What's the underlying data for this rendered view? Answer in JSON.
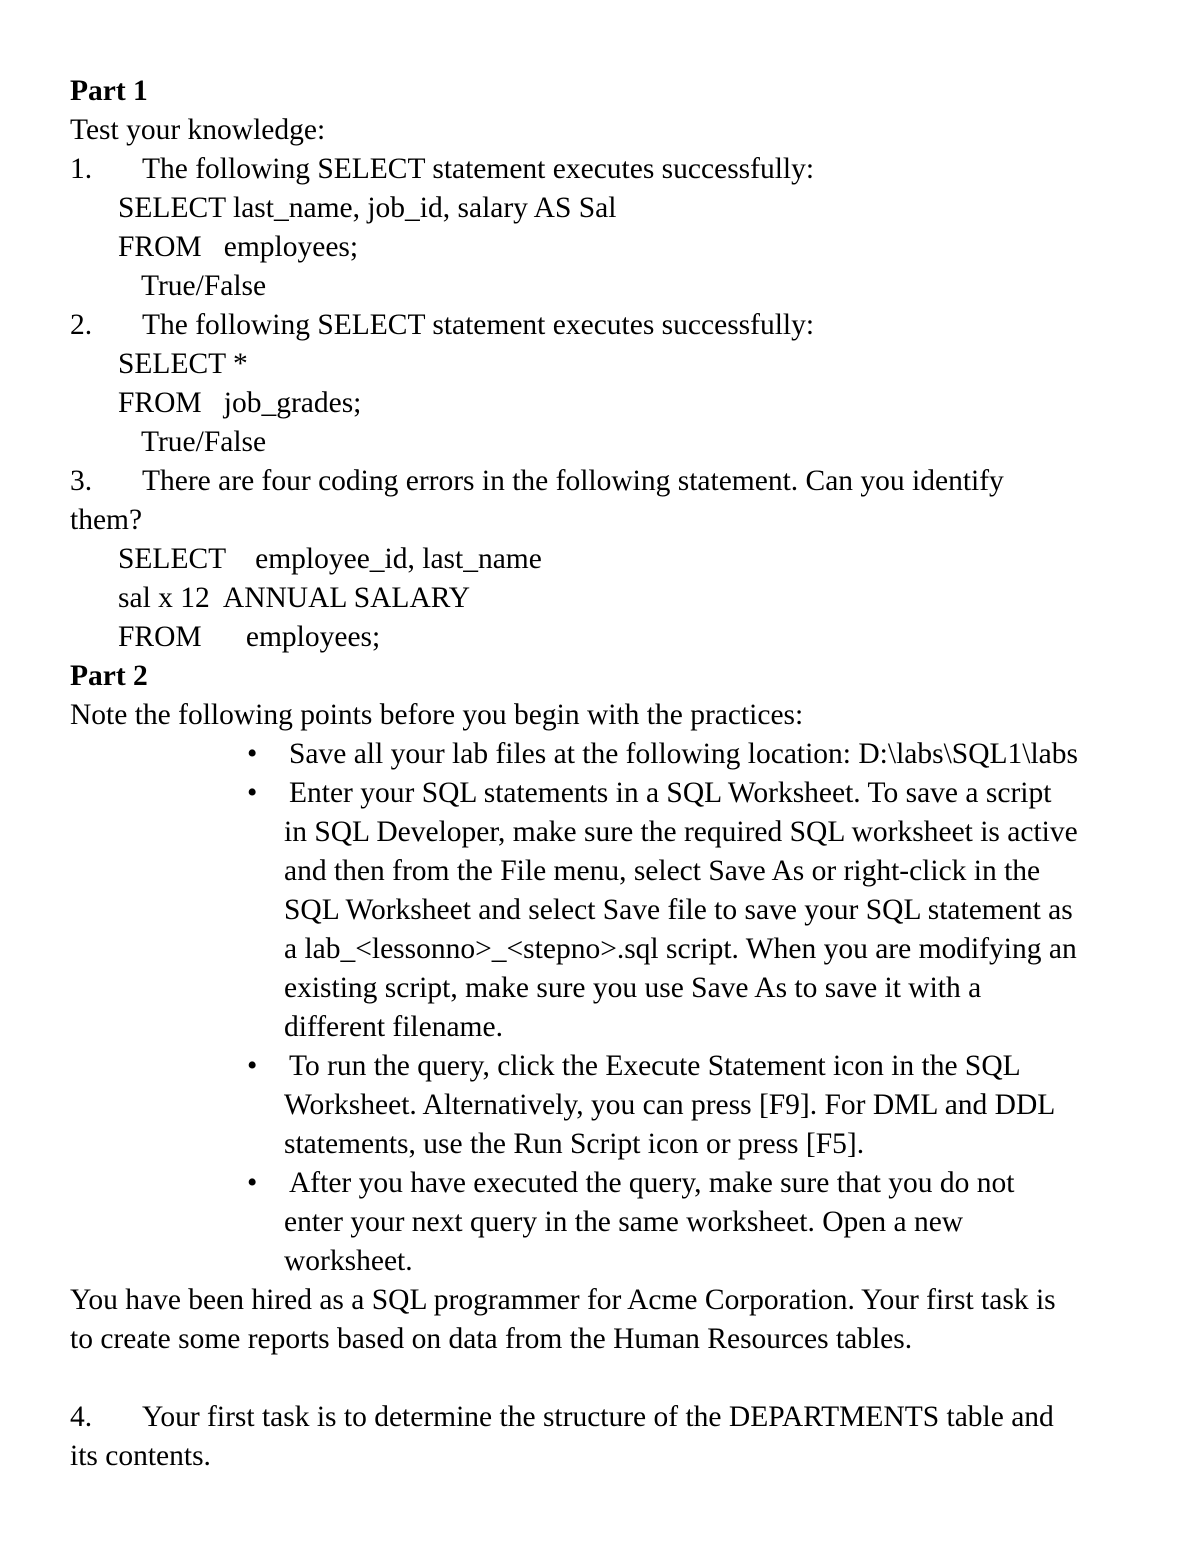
{
  "document": {
    "part1": {
      "heading": "Part 1",
      "intro": "Test your knowledge:",
      "questions": [
        {
          "number": "1.",
          "prompt": "The following SELECT statement executes successfully:",
          "code": [
            "SELECT last_name, job_id, salary AS Sal",
            "FROM   employees;"
          ],
          "answer": "True/False"
        },
        {
          "number": "2.",
          "prompt": "The following SELECT statement executes successfully:",
          "code": [
            "SELECT *",
            "FROM   job_grades;"
          ],
          "answer": "True/False"
        },
        {
          "number": "3.",
          "prompt": "There are four coding errors in the following statement. Can you identify",
          "prompt_cont": "them?",
          "code": [
            "SELECT    employee_id, last_name",
            "sal x 12  ANNUAL SALARY",
            "FROM      employees;"
          ]
        }
      ]
    },
    "part2": {
      "heading": "Part 2",
      "intro": "Note the following points before you begin with the practices:",
      "bullet_glyph": "•",
      "bullets": [
        [
          "Save all your lab files at the following location: D:\\labs\\SQL1\\labs"
        ],
        [
          "Enter your SQL statements in a SQL Worksheet. To save a script",
          "in SQL Developer, make sure the required SQL worksheet is active",
          "and then from the File menu, select Save As or right-click in the",
          "SQL Worksheet and select Save file to save your SQL statement as",
          "a lab_<lessonno>_<stepno>.sql script. When you are modifying an",
          "existing script, make sure you use Save As to save it with a",
          "different filename."
        ],
        [
          "To run the query, click the Execute Statement icon in the SQL",
          "Worksheet. Alternatively, you can press [F9]. For DML and DDL",
          "statements, use the Run Script icon or press [F5]."
        ],
        [
          "After you have executed the query, make sure that you do not",
          "enter your next query in the same worksheet. Open a new",
          "worksheet."
        ]
      ],
      "scenario": [
        "You have been hired as a SQL programmer for Acme Corporation. Your first task is",
        "to create some reports based on data from the Human Resources tables."
      ],
      "task4": {
        "number": "4.",
        "text": "Your first task is to determine the structure of the DEPARTMENTS table and",
        "text_cont": "its contents."
      }
    }
  }
}
